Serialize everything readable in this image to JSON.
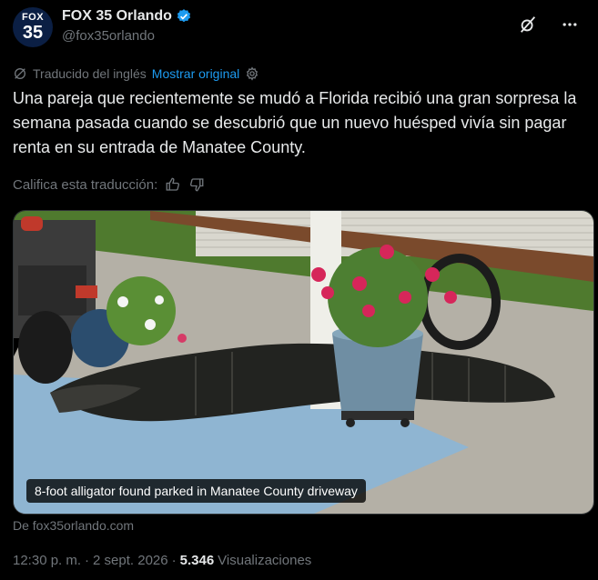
{
  "account": {
    "avatar_line1": "FOX",
    "avatar_line2": "35",
    "display_name": "FOX 35 Orlando",
    "handle": "@fox35orlando"
  },
  "translation": {
    "note": "Traducido del inglés",
    "show_original": "Mostrar original"
  },
  "tweet": {
    "text": "Una pareja que recientemente se mudó a Florida recibió una gran sorpresa la semana pasada cuando se descubrió que un nuevo huésped vivía sin pagar renta en su entrada de Manatee County."
  },
  "rating": {
    "label": "Califica esta traducción:"
  },
  "media": {
    "caption": "8-foot alligator found parked in Manatee County driveway",
    "source": "De fox35orlando.com"
  },
  "meta": {
    "time": "12:30 p. m.",
    "separator": "·",
    "date": "2 sept. 2026",
    "views_count": "5.346",
    "views_label": "Visualizaciones"
  },
  "colors": {
    "background": "#000000",
    "text": "#e7e9ea",
    "muted": "#71767b",
    "accent": "#1d9bf0"
  }
}
